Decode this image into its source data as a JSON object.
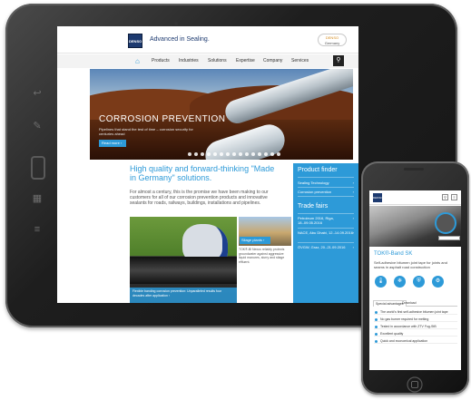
{
  "site": {
    "logo_text": "DENSO",
    "tagline": "Advanced in Sealing.",
    "badge_lines": [
      "DENSO",
      "Germany"
    ],
    "nav": {
      "home_icon": "home-icon",
      "items": [
        "Products",
        "Industries",
        "Solutions",
        "Expertise",
        "Company",
        "Services"
      ],
      "search_icon": "search-icon"
    },
    "hero": {
      "title": "CORROSION PREVENTION",
      "subtitle": "Pipelines that stand the test of time – corrosion security for centuries ahead",
      "button": "Read more ›"
    },
    "headline": "High quality and forward-thinking \"Made in Germany\" solutions.",
    "body": "For almost a century, this is the promise we have been making to our customers for all of our corrosion prevention products and innovative sealants for roads, railways, buildings, installations and pipelines.",
    "sidebar": {
      "product_finder_title": "Product finder",
      "product_items": [
        "Sealing Technology",
        "Corrosion prevention"
      ],
      "trade_fairs_title": "Trade fairs",
      "trade_items": [
        "Petroleum 2016, Riga, 18.-09.05.2016",
        "NACE, Abu Dhabi, 12.-14.09.2016",
        "ÖVGW, Graz, 20.-21.09.2016"
      ]
    },
    "feature_main_caption": "Flexible banding corrosion prevention: Unparalleled results four decades after application ›",
    "feature_side_label": "Silage plants ›",
    "feature_side_text": "TOK®-Bl Nexus reliably protects groundwater against aggressive liquid manures, slurry and silage effluent."
  },
  "phone": {
    "logo_text": "DENSO",
    "icons": [
      "search-icon",
      "menu-icon"
    ],
    "product_title": "TOK®-Band SK",
    "product_desc": "Self-adhesive bitumen joint tape for joints and seams in asphalt road construction",
    "feature_icons": [
      "thermometer-icon",
      "snowflake-icon",
      "shield-icon",
      "gear-icon"
    ],
    "tabs": [
      "Special advantages",
      "Download"
    ],
    "features": [
      "The world's first self-adhesive bitumen joint tape",
      "No gas burner required for melting",
      "Tested in accordance with ZTV Fug-StB",
      "Excellent quality",
      "Quick and economical application"
    ]
  },
  "colors": {
    "accent": "#2d9ad8",
    "brand": "#1d3a70"
  }
}
